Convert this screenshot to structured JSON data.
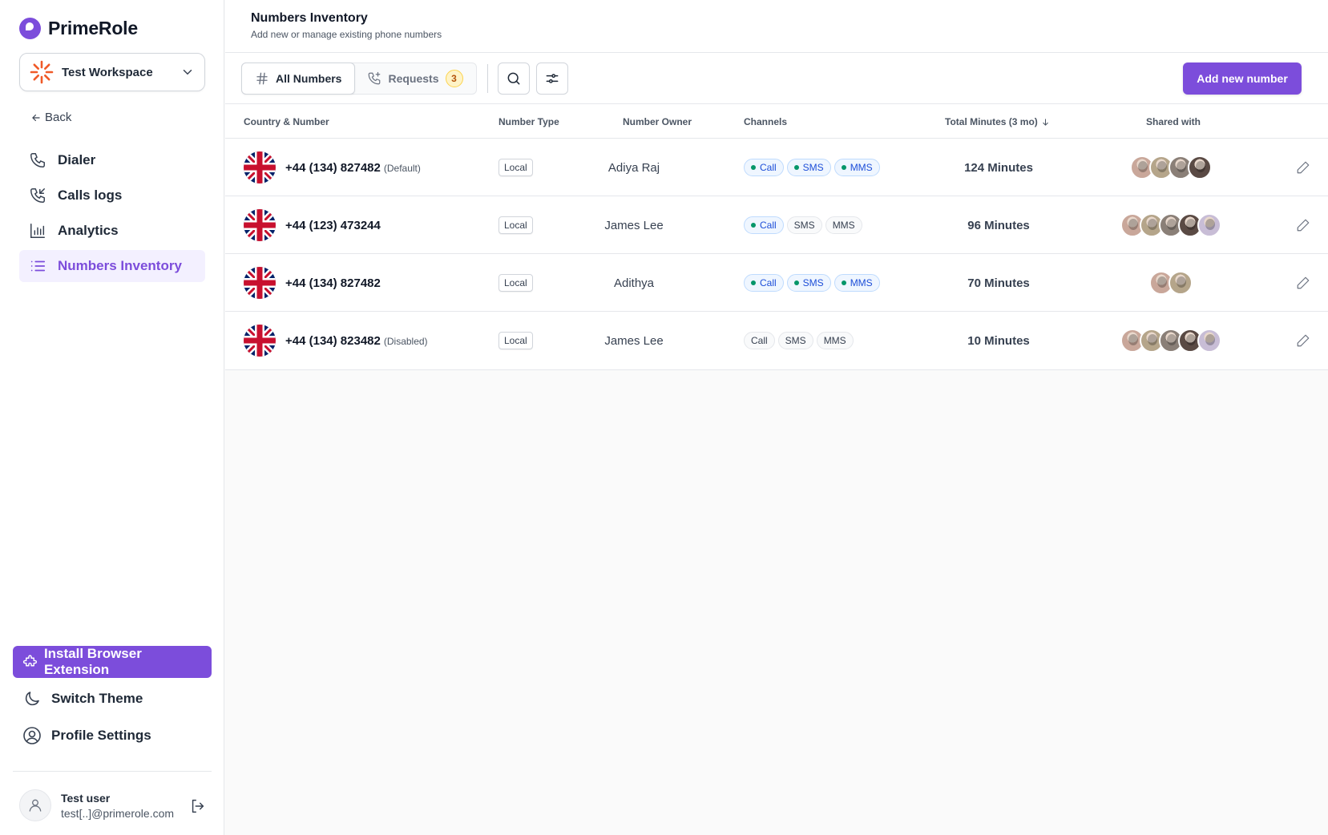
{
  "app": {
    "name": "PrimeRole",
    "brand_color": "#7c4ddb"
  },
  "workspace": {
    "name": "Test Workspace"
  },
  "sidebar": {
    "back_label": "Back",
    "items": [
      {
        "label": "Dialer",
        "icon": "phone-icon",
        "active": false
      },
      {
        "label": "Calls logs",
        "icon": "phone-incoming-icon",
        "active": false
      },
      {
        "label": "Analytics",
        "icon": "bar-chart-icon",
        "active": false
      },
      {
        "label": "Numbers Inventory",
        "icon": "list-icon",
        "active": true
      }
    ],
    "install_label": "Install Browser Extension",
    "theme_label": "Switch Theme",
    "profile_label": "Profile Settings",
    "user": {
      "name": "Test user",
      "email": "test[..]@primerole.com"
    }
  },
  "header": {
    "title": "Numbers Inventory",
    "subtitle": "Add new or manage existing phone numbers"
  },
  "toolbar": {
    "tabs": [
      {
        "label": "All Numbers",
        "active": true
      },
      {
        "label": "Requests",
        "badge": "3",
        "active": false
      }
    ],
    "add_label": "Add new number"
  },
  "table": {
    "columns": [
      "Country & Number",
      "Number Type",
      "Number Owner",
      "Channels",
      "Total Minutes (3 mo)",
      "Shared with"
    ],
    "rows": [
      {
        "number": "+44 (134) 827482",
        "note": "(Default)",
        "type": "Local",
        "owner": "Adiya Raj",
        "channels": [
          {
            "label": "Call",
            "on": true
          },
          {
            "label": "SMS",
            "on": true
          },
          {
            "label": "MMS",
            "on": true
          }
        ],
        "minutes": "124 Minutes",
        "shared": [
          "#c9a79a",
          "#b5a58a",
          "#8a7f77",
          "#5a4a44"
        ]
      },
      {
        "number": "+44 (123) 473244",
        "note": "",
        "type": "Local",
        "owner": "James Lee",
        "channels": [
          {
            "label": "Call",
            "on": true
          },
          {
            "label": "SMS",
            "on": false
          },
          {
            "label": "MMS",
            "on": false
          }
        ],
        "minutes": "96 Minutes",
        "shared": [
          "#c9a79a",
          "#b5a58a",
          "#8a7f77",
          "#5a4a44",
          "#c8bdd6"
        ]
      },
      {
        "number": "+44 (134) 827482",
        "note": "",
        "type": "Local",
        "owner": "Adithya",
        "channels": [
          {
            "label": "Call",
            "on": true
          },
          {
            "label": "SMS",
            "on": true
          },
          {
            "label": "MMS",
            "on": true
          }
        ],
        "minutes": "70 Minutes",
        "shared": [
          "#c9a79a",
          "#b5a58a"
        ]
      },
      {
        "number": "+44 (134) 823482",
        "note": "(Disabled)",
        "type": "Local",
        "owner": "James Lee",
        "channels": [
          {
            "label": "Call",
            "on": false
          },
          {
            "label": "SMS",
            "on": false
          },
          {
            "label": "MMS",
            "on": false
          }
        ],
        "minutes": "10 Minutes",
        "shared": [
          "#c9a79a",
          "#b5a58a",
          "#8a7f77",
          "#5a4a44",
          "#c8bdd6"
        ]
      }
    ]
  }
}
